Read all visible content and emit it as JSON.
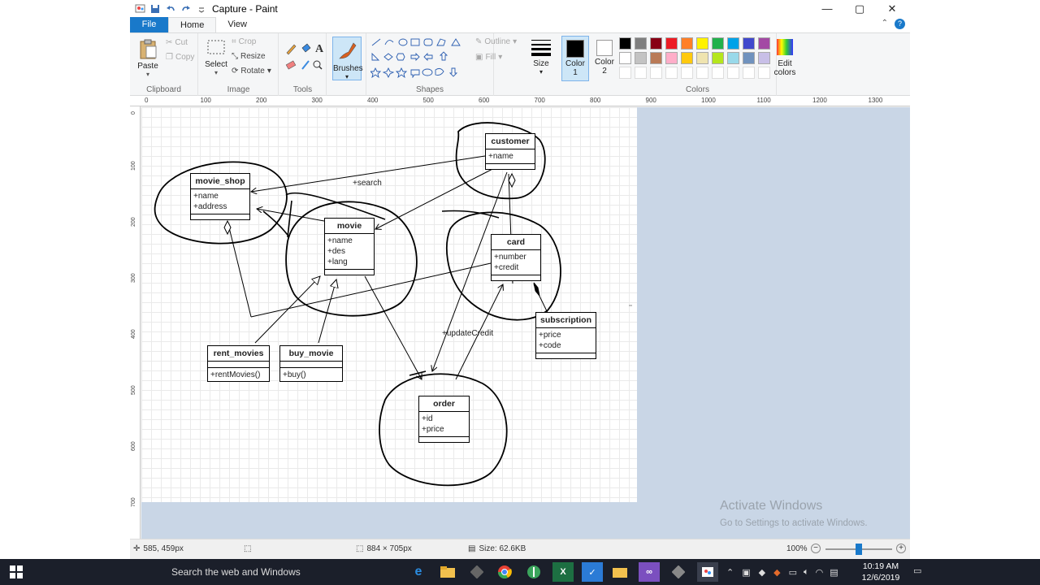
{
  "window": {
    "title": "Capture - Paint",
    "controls": {
      "minimize": "—",
      "maximize": "▢",
      "close": "✕"
    }
  },
  "tabs": [
    {
      "label": "File"
    },
    {
      "label": "Home"
    },
    {
      "label": "View"
    }
  ],
  "ribbon": {
    "clipboard": {
      "label": "Clipboard",
      "paste": "Paste",
      "cut": "Cut",
      "copy": "Copy"
    },
    "image": {
      "label": "Image",
      "select": "Select",
      "crop": "Crop",
      "resize": "Resize",
      "rotate": "Rotate"
    },
    "tools": {
      "label": "Tools"
    },
    "brushes": {
      "label": "Brushes"
    },
    "shapes": {
      "label": "Shapes",
      "outline": "Outline",
      "fill": "Fill"
    },
    "size": {
      "label": "Size"
    },
    "color1": {
      "label": "Color 1",
      "line1": "Color",
      "line2": "1"
    },
    "color2": {
      "label": "Color 2",
      "line1": "Color",
      "line2": "2"
    },
    "colors": {
      "label": "Colors"
    },
    "edit_colors": {
      "line1": "Edit",
      "line2": "colors"
    },
    "palette": [
      "#000000",
      "#7f7f7f",
      "#880015",
      "#ed1c24",
      "#ff7f27",
      "#fff200",
      "#22b14c",
      "#00a2e8",
      "#3f48cc",
      "#a349a4",
      "#ffffff",
      "#c3c3c3",
      "#b97a57",
      "#ffaec9",
      "#ffc90e",
      "#efe4b0",
      "#b5e61d",
      "#99d9ea",
      "#7092be",
      "#c8bfe7"
    ]
  },
  "ruler": {
    "top": [
      "0",
      "100",
      "200",
      "300",
      "400",
      "500",
      "600",
      "700",
      "800",
      "900",
      "1000",
      "1100",
      "1200",
      "1300"
    ],
    "left": [
      "0",
      "100",
      "200",
      "300",
      "400",
      "500",
      "600",
      "700"
    ]
  },
  "diagram": {
    "classes": [
      {
        "name": "customer",
        "attrs": [
          "+name"
        ],
        "ops": []
      },
      {
        "name": "movie_shop",
        "attrs": [
          "+name",
          "+address"
        ],
        "ops": []
      },
      {
        "name": "movie",
        "attrs": [
          "+name",
          "+des",
          "+lang"
        ],
        "ops": []
      },
      {
        "name": "card",
        "attrs": [
          "+number",
          "+credit"
        ],
        "ops": []
      },
      {
        "name": "subscription",
        "attrs": [
          "+price",
          "+code"
        ],
        "ops": []
      },
      {
        "name": "rent_movies",
        "attrs": [],
        "ops": [
          "+rentMovies()"
        ]
      },
      {
        "name": "buy_movie",
        "attrs": [],
        "ops": [
          "+buy()"
        ]
      },
      {
        "name": "order",
        "attrs": [
          "+id",
          "+price"
        ],
        "ops": []
      }
    ],
    "edge_labels": {
      "search": "+search",
      "update_credit": "+updateCredit"
    }
  },
  "watermark": {
    "title": "Activate Windows",
    "subtitle": "Go to Settings to activate Windows."
  },
  "status": {
    "cursor_pos": "585, 459px",
    "image_size": "884 × 705px",
    "file_size": "Size: 62.6KB",
    "zoom": "100%",
    "zoom_fraction": 0.5
  },
  "taskbar": {
    "search_placeholder": "Search the web and Windows",
    "time": "10:19 AM",
    "date": "12/6/2019"
  }
}
